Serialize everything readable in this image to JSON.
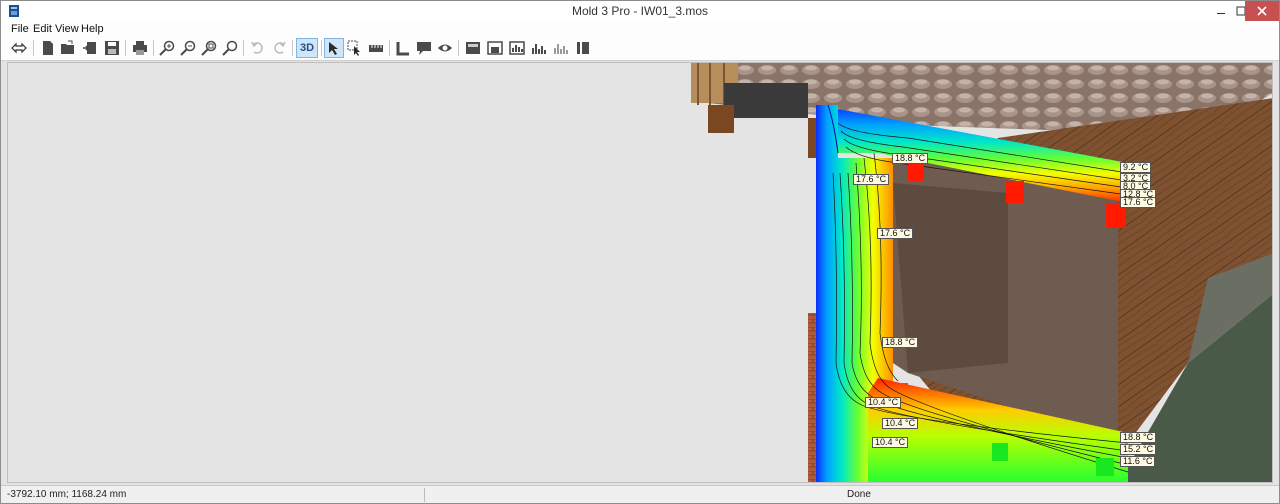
{
  "window": {
    "title": "Mold 3 Pro - IW01_3.mos"
  },
  "menu": {
    "file": "File",
    "edit": "Edit",
    "view": "View",
    "help": "Help"
  },
  "toolbar": {
    "mode_3d_label": "3D",
    "icons": [
      "pan-icon",
      "new-file-icon",
      "open-icon",
      "import-icon",
      "save-icon",
      "print-icon",
      "zoom-in-icon",
      "zoom-out-icon",
      "zoom-all-icon",
      "zoom-window-icon",
      "undo-icon",
      "redo-icon",
      "3d-view-icon",
      "select-icon",
      "select-box-icon",
      "measure-icon",
      "corner-icon",
      "comment-icon",
      "visibility-icon",
      "material-icon",
      "mesh-icon",
      "result-icon",
      "chart-icon",
      "chart2-icon",
      "calc-icon"
    ]
  },
  "viewport": {
    "temperature_labels": [
      {
        "text": "18.8 °C"
      },
      {
        "text": "17.6 °C"
      },
      {
        "text": "17.6 °C"
      },
      {
        "text": "18.8 °C"
      },
      {
        "text": "10.4 °C"
      },
      {
        "text": "10.4 °C"
      },
      {
        "text": "10.4 °C"
      },
      {
        "text": "9.2 °C"
      },
      {
        "text": "3.2 °C"
      },
      {
        "text": "8.0 °C"
      },
      {
        "text": "12.8 °C"
      },
      {
        "text": "17.6 °C"
      },
      {
        "text": "18.8 °C"
      },
      {
        "text": "15.2 °C"
      },
      {
        "text": "11.6 °C"
      }
    ]
  },
  "statusbar": {
    "coordinates": "-3792.10 mm; 1168.24 mm",
    "status": "Done"
  }
}
